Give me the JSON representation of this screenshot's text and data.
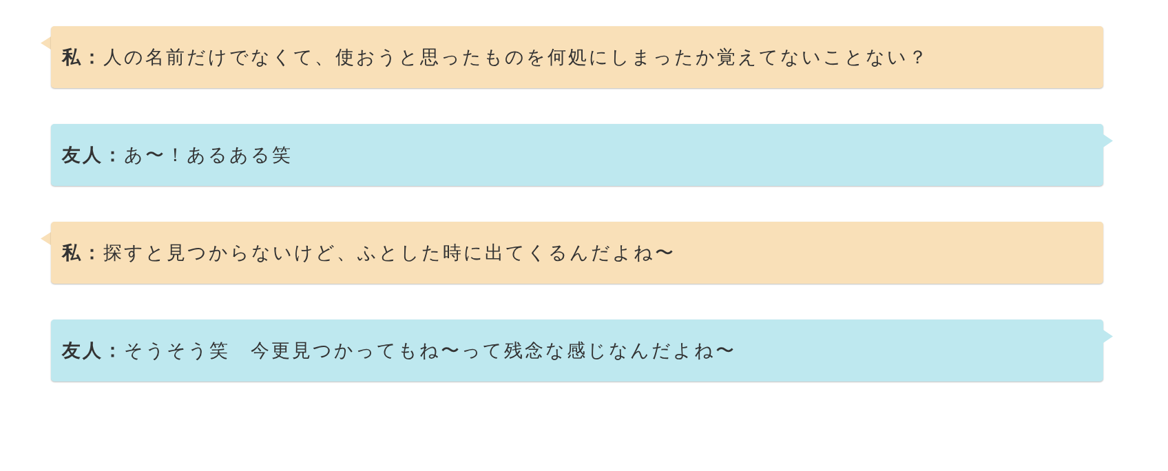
{
  "messages": [
    {
      "speaker": "私：",
      "text": "人の名前だけでなくて、使おうと思ったものを何処にしまったか覚えてないことない？",
      "kind": "left",
      "color": "#f9e0b8"
    },
    {
      "speaker": "友人：",
      "text": "あ〜！あるある笑",
      "kind": "right",
      "color": "#bee8ef"
    },
    {
      "speaker": "私：",
      "text": "探すと見つからないけど、ふとした時に出てくるんだよね〜",
      "kind": "left",
      "color": "#f9e0b8"
    },
    {
      "speaker": "友人：",
      "text": "そうそう笑　今更見つかってもね〜って残念な感じなんだよね〜",
      "kind": "right",
      "color": "#bee8ef"
    }
  ]
}
